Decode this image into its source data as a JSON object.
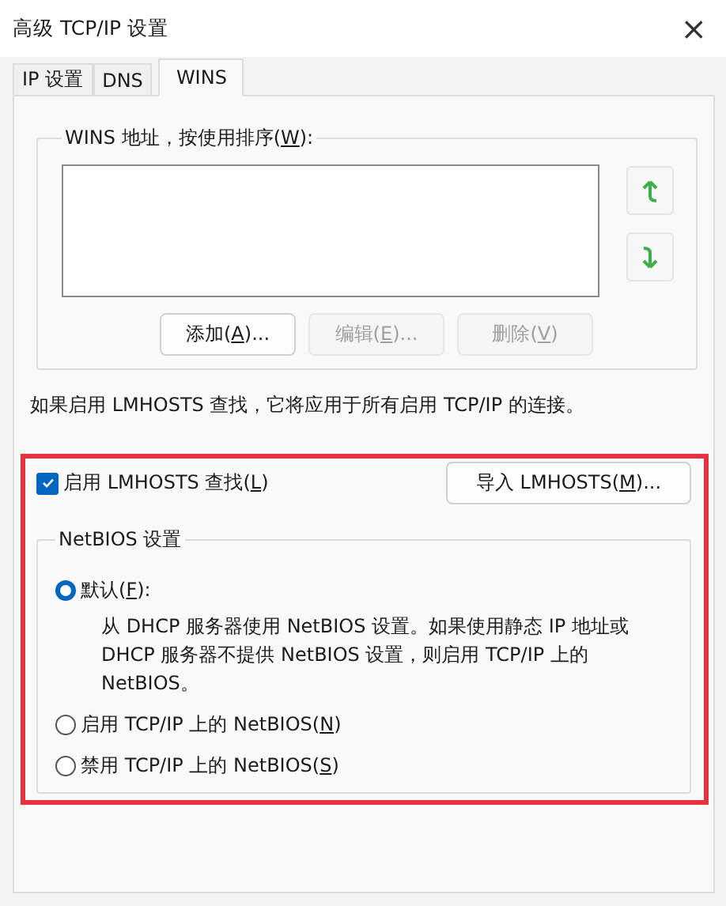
{
  "window": {
    "title": "高级 TCP/IP 设置",
    "close": "×"
  },
  "tabs": [
    {
      "label": "IP 设置",
      "selected": false
    },
    {
      "label": "DNS",
      "selected": false
    },
    {
      "label": "WINS",
      "selected": true
    }
  ],
  "wins_group": {
    "title": {
      "before": "WINS 地址，按使用排序(",
      "key": "W",
      "after": "):"
    },
    "buttons": [
      {
        "label": {
          "before": "添加(",
          "key": "A",
          "after": ")..."
        },
        "disabled": false
      },
      {
        "label": {
          "before": "编辑(",
          "key": "E",
          "after": ")..."
        },
        "disabled": true
      },
      {
        "label": {
          "before": "删除(",
          "key": "V",
          "after": ")"
        },
        "disabled": true
      }
    ]
  },
  "info": "如果启用 LMHOSTS 查找，它将应用于所有启用 TCP/IP 的连接。",
  "lmhosts": {
    "label": {
      "before": "启用 LMHOSTS 查找(",
      "key": "L",
      "after": ")"
    },
    "checked": true,
    "import_button": {
      "before": "导入 LMHOSTS(",
      "key": "M",
      "after": ")..."
    }
  },
  "netbios": {
    "title": "NetBIOS 设置",
    "options": [
      {
        "label": {
          "before": "默认(",
          "key": "F",
          "after": "):"
        },
        "selected": true,
        "description": "从 DHCP 服务器使用 NetBIOS 设置。如果使用静态 IP 地址或 DHCP 服务器不提供 NetBIOS 设置，则启用 TCP/IP 上的 NetBIOS。"
      },
      {
        "label": {
          "before": "启用 TCP/IP 上的 NetBIOS(",
          "key": "N",
          "after": ")"
        },
        "selected": false
      },
      {
        "label": {
          "before": "禁用 TCP/IP 上的 NetBIOS(",
          "key": "S",
          "after": ")"
        },
        "selected": false
      }
    ]
  }
}
